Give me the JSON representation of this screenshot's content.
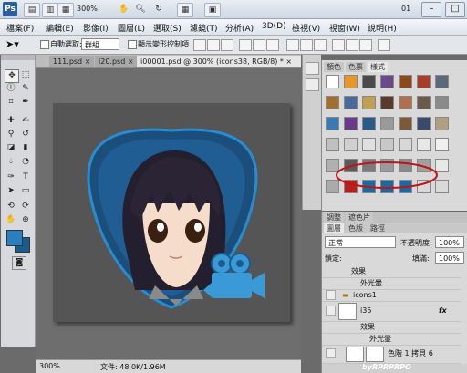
{
  "titlebar": {
    "logo": "Ps",
    "zoom": "300%",
    "doc_num": "01",
    "controls": [
      "–",
      "□",
      "✕"
    ]
  },
  "menu": [
    "檔案(F)",
    "編輯(E)",
    "影像(I)",
    "圖層(L)",
    "選取(S)",
    "濾鏡(T)",
    "分析(A)",
    "3D(D)",
    "檢視(V)",
    "視窗(W)",
    "說明(H)"
  ],
  "options": {
    "auto_select": "自動選取:",
    "auto_select_value": "群組",
    "transform": "顯示變形控制項"
  },
  "doc_tabs": [
    "111.psd",
    "i20.psd",
    "i00001.psd @ 300% (icons38, RGB/8) *"
  ],
  "doc_tab_close": "×",
  "status": {
    "zoom": "300%",
    "file": "文件: 48.0K/1.96M"
  },
  "styles_panel": {
    "tabs": [
      "顏色",
      "色票",
      "樣式"
    ],
    "active_tab": 2
  },
  "layers_panel": {
    "group_tabs": [
      "調整",
      "遮色片"
    ],
    "tabs": [
      "圖層",
      "色版",
      "路徑"
    ],
    "blend_mode": "正常",
    "opacity_label": "不透明度:",
    "opacity": "100%",
    "lock_label": "鎖定:",
    "fill_label": "填滿:",
    "fill": "100%",
    "rows": [
      {
        "text": "效果",
        "indent": 2
      },
      {
        "text": "外光暈",
        "indent": 3
      },
      {
        "text": "icons1",
        "indent": 1
      },
      {
        "text": "i35",
        "indent": 1
      },
      {
        "text": "效果",
        "indent": 2
      },
      {
        "text": "外光暈",
        "indent": 3
      },
      {
        "text": "色階 1 拷貝 6",
        "indent": 1
      }
    ],
    "fx_label": "fx"
  },
  "watermark": "byRPRPRPO",
  "colors": {
    "accent": "#2a7fc0",
    "foreground": "#2a7fc0",
    "background": "#1a5c8c",
    "highlight_circle": "#c0141a",
    "canvas": "#555556"
  },
  "style_swatches": [
    [
      "#ffffff",
      "#e8952a",
      "#4a4a4a",
      "#6a4a8a",
      "#8a4a1a",
      "#aa3a2a",
      "#5a6a7a"
    ],
    [
      "#a07030",
      "#4a6a9a",
      "#c0a050",
      "#5a3a2a",
      "#b07050",
      "#6a5a4a",
      "#8a8a8a"
    ],
    [
      "#3a7ab0",
      "#6a3a8a",
      "#2a5a8a",
      "#9a9a9a",
      "#7a5a3a",
      "#3a4a6a",
      "#b0a080"
    ],
    [
      "#c0c0c0",
      "#d0d0d0",
      "#e0e0e0",
      "#c8c8c8",
      "#d8d8d8",
      "#e8e8e8",
      "#f0f0f0"
    ],
    [
      "#b0b0b0",
      "#5a5a5a",
      "#7a7a7a",
      "#9a9a9a",
      "#8a8a8a",
      "#a0a0a0",
      "#e8e8e8"
    ],
    [
      "#aaaaaa",
      "#b82020",
      "#1a6aa0",
      "#1a6aa0",
      "#1a6aa0",
      "#d9d9d9",
      "#d9d9d9"
    ]
  ]
}
